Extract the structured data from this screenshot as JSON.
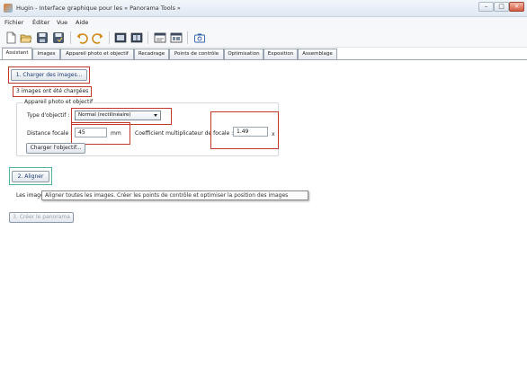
{
  "window": {
    "title": "Hugin - Interface graphique pour les « Panorama Tools »"
  },
  "menu": [
    "Fichier",
    "Éditer",
    "Vue",
    "Aide"
  ],
  "toolbar": {
    "icons": [
      "new-project-icon",
      "open-folder-icon",
      "save-icon",
      "save-as-icon",
      "undo-icon",
      "redo-icon",
      "add-images-icon",
      "control-points-icon",
      "preview-icon",
      "fast-preview-icon",
      "camera-icon"
    ]
  },
  "tabs": [
    "Assistant",
    "Images",
    "Appareil photo et objectif",
    "Recadrage",
    "Points de contrôle",
    "Optimisation",
    "Exposition",
    "Assemblage"
  ],
  "assistant": {
    "load_button": "1. Charger des images...",
    "status_loaded": "3 images ont été chargées",
    "group_title": "Appareil photo et objectif",
    "lens_type_label": "Type d'objectif :",
    "lens_type_value": "Normal (rectilinéaire)",
    "focal_label": "Distance focale :",
    "focal_value": "45",
    "focal_unit": "mm",
    "crop_label": "Coefficient multiplicateur de focale :",
    "crop_value": "1.49",
    "crop_unit": "x",
    "load_lens_button": "Charger l'objectif...",
    "align_button": "2. Aligner",
    "images_label_partial": "Les image",
    "tooltip": "Aligner toutes les images. Créer les points de contrôle et optimiser la position des images",
    "create_button": "3. Créer le panorama"
  },
  "colors": {
    "annotation_red": "#c0392b",
    "annotation_teal": "#4fb3a4"
  }
}
